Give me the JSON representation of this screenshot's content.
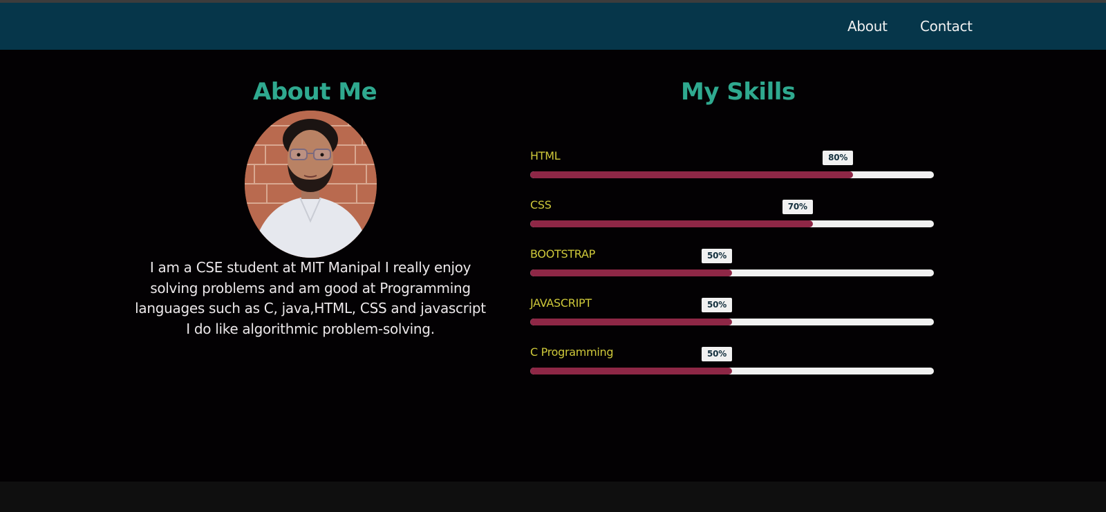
{
  "nav": {
    "about_label": "About",
    "contact_label": "Contact"
  },
  "about": {
    "title": "About Me",
    "description": "I am a CSE student at MIT Manipal I really enjoy solving problems and am good at Programming languages such as C, java,HTML, CSS and javascript I do like algorithmic problem-solving."
  },
  "skills": {
    "title": "My Skills",
    "items": [
      {
        "name": "HTML",
        "percent_label": "80%",
        "level": 0.8
      },
      {
        "name": "CSS",
        "percent_label": "70%",
        "level": 0.7
      },
      {
        "name": "BOOTSTRAP",
        "percent_label": "50%",
        "level": 0.5
      },
      {
        "name": "JAVASCRIPT",
        "percent_label": "50%",
        "level": 0.5
      },
      {
        "name": "C Programming",
        "percent_label": "50%",
        "level": 0.5
      }
    ]
  },
  "colors": {
    "navbar": "#06364a",
    "heading": "#2fa98f",
    "skill_label": "#cfc93a",
    "bar_fill": "#8e2746",
    "bar_track": "#f1f1f1",
    "background": "#030103"
  }
}
